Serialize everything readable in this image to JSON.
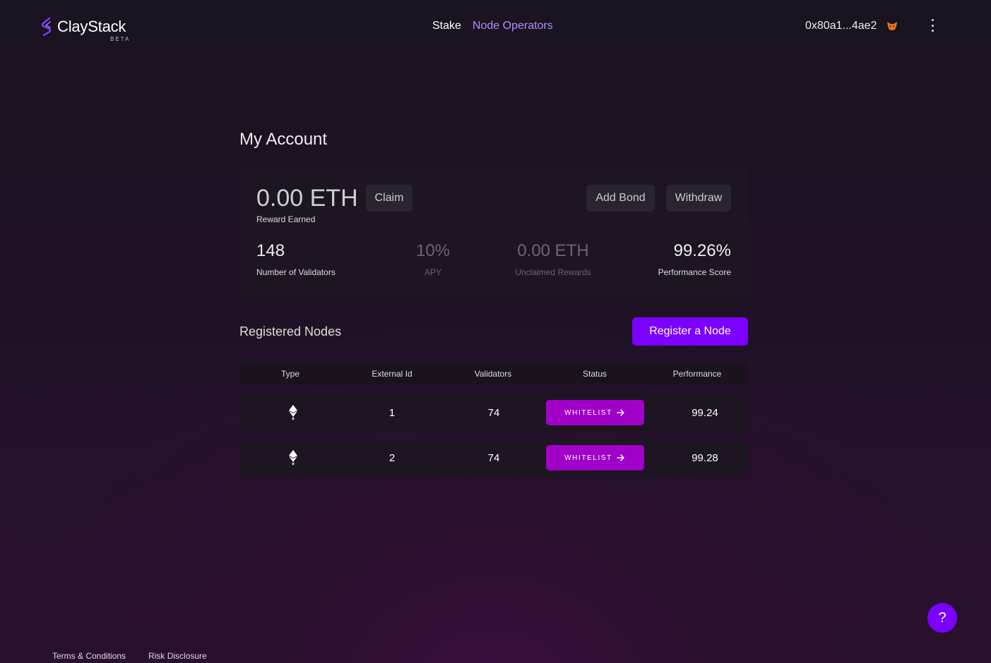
{
  "header": {
    "logo_text": "ClayStack",
    "logo_badge": "BETA",
    "nav": {
      "stake": "Stake",
      "node_operators": "Node Operators"
    },
    "wallet_address": "0x80a1...4ae2",
    "wallet_icon": "metamask-fox-icon",
    "menu_icon": "kebab-menu-icon"
  },
  "account": {
    "title": "My Account",
    "reward_value": "0.00 ETH",
    "reward_label": "Reward Earned",
    "claim_label": "Claim",
    "add_bond_label": "Add Bond",
    "withdraw_label": "Withdraw",
    "stats": {
      "validators_value": "148",
      "validators_label": "Number of Validators",
      "apy_value": "10%",
      "apy_label": "APY",
      "unclaimed_value": "0.00 ETH",
      "unclaimed_label": "Unclaimed Rewards",
      "performance_value": "99.26%",
      "performance_label": "Performance Score"
    }
  },
  "nodes": {
    "title": "Registered Nodes",
    "register_label": "Register a Node",
    "columns": {
      "type": "Type",
      "external_id": "External Id",
      "validators": "Validators",
      "status": "Status",
      "performance": "Performance"
    },
    "rows": [
      {
        "type_icon": "ethereum-icon",
        "external_id": "1",
        "validators": "74",
        "status": "WHITELIST",
        "performance": "99.24"
      },
      {
        "type_icon": "ethereum-icon",
        "external_id": "2",
        "validators": "74",
        "status": "WHITELIST",
        "performance": "99.28"
      }
    ]
  },
  "footer": {
    "terms": "Terms & Conditions",
    "risk": "Risk Disclosure"
  },
  "help_label": "?",
  "colors": {
    "accent": "#7b00ff",
    "status_button": "#a100c8",
    "nav_active": "#b48cff"
  }
}
